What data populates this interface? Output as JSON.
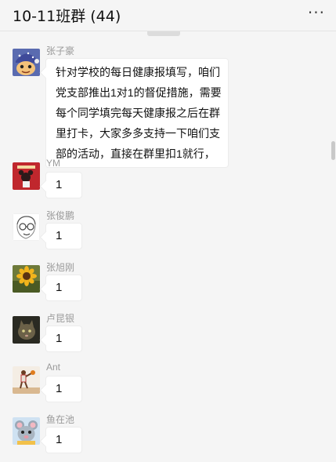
{
  "header": {
    "title": "10-11班群 (44)",
    "more_label": "···"
  },
  "messages": [
    {
      "sender": "张子豪",
      "avatar_icon": "cartoon-face-avatar",
      "lines": [
        "针对学校的每日健康报填写，咱们",
        "党支部推出1对1的督促措施，需要",
        "每个同学填完每天健康报之后在群",
        "里打卡，大家多多支持一下咱们支",
        "部的活动，直接在群里扣1就行，"
      ]
    },
    {
      "sender": "YM",
      "avatar_icon": "red-poster-avatar",
      "text": "1"
    },
    {
      "sender": "张俊鹏",
      "avatar_icon": "sketch-face-avatar",
      "text": "1"
    },
    {
      "sender": "张旭刚",
      "avatar_icon": "sunflower-avatar",
      "text": "1"
    },
    {
      "sender": "卢昆银",
      "avatar_icon": "cat-photo-avatar",
      "text": "1"
    },
    {
      "sender": "Ant",
      "avatar_icon": "basketball-player-avatar",
      "text": "1"
    },
    {
      "sender": "鱼在池",
      "avatar_icon": "cartoon-mouse-avatar",
      "text": "1"
    }
  ]
}
